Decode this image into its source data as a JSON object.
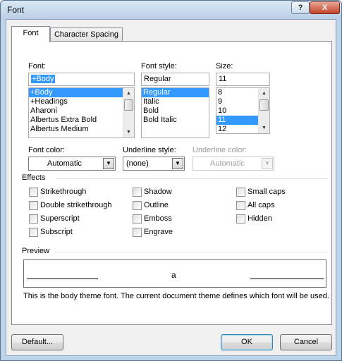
{
  "window": {
    "title": "Font",
    "help_label": "?",
    "close_label": "X"
  },
  "tabs": [
    "Font",
    "Character Spacing"
  ],
  "font": {
    "label": "Font:",
    "value": "+Body",
    "items": [
      "+Body",
      "+Headings",
      "Aharoni",
      "Albertus Extra Bold",
      "Albertus Medium"
    ],
    "selected_index": 0
  },
  "font_style": {
    "label": "Font style:",
    "value": "Regular",
    "items": [
      "Regular",
      "Italic",
      "Bold",
      "Bold Italic"
    ],
    "selected_index": 0
  },
  "size": {
    "label": "Size:",
    "value": "11",
    "items": [
      "8",
      "9",
      "10",
      "11",
      "12"
    ],
    "selected_index": 3
  },
  "font_color": {
    "label": "Font color:",
    "value": "Automatic"
  },
  "underline_style": {
    "label": "Underline style:",
    "value": "(none)"
  },
  "underline_color": {
    "label": "Underline color:",
    "value": "Automatic",
    "enabled": false
  },
  "effects": {
    "title": "Effects",
    "col1": [
      "Strikethrough",
      "Double strikethrough",
      "Superscript",
      "Subscript"
    ],
    "col2": [
      "Shadow",
      "Outline",
      "Emboss",
      "Engrave"
    ],
    "col3": [
      "Small caps",
      "All caps",
      "Hidden"
    ]
  },
  "preview": {
    "title": "Preview",
    "sample_text": "a",
    "description": "This is the body theme font. The current document theme defines which font will be used."
  },
  "buttons": {
    "default_label": "Default...",
    "ok_label": "OK",
    "cancel_label": "Cancel"
  },
  "icons": {
    "dropdown": "dropdown-arrow-icon",
    "scroll_up": "scroll-up-arrow-icon",
    "scroll_down": "scroll-down-arrow-icon"
  }
}
